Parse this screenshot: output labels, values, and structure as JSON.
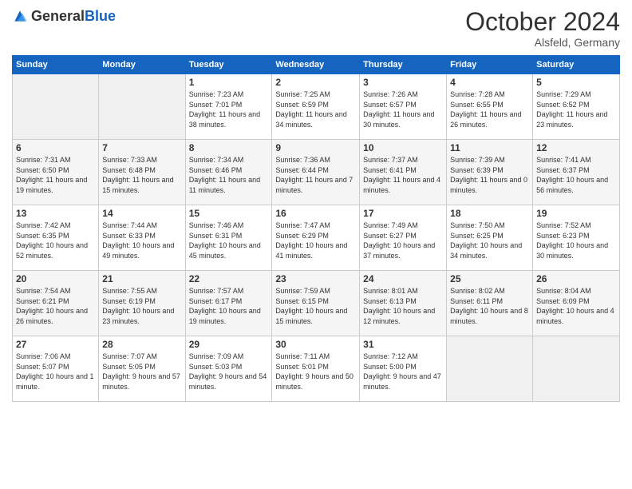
{
  "header": {
    "logo_general": "General",
    "logo_blue": "Blue",
    "month_title": "October 2024",
    "location": "Alsfeld, Germany"
  },
  "days_of_week": [
    "Sunday",
    "Monday",
    "Tuesday",
    "Wednesday",
    "Thursday",
    "Friday",
    "Saturday"
  ],
  "weeks": [
    [
      {
        "day": null
      },
      {
        "day": null
      },
      {
        "day": 1,
        "sunrise": "Sunrise: 7:23 AM",
        "sunset": "Sunset: 7:01 PM",
        "daylight": "Daylight: 11 hours and 38 minutes."
      },
      {
        "day": 2,
        "sunrise": "Sunrise: 7:25 AM",
        "sunset": "Sunset: 6:59 PM",
        "daylight": "Daylight: 11 hours and 34 minutes."
      },
      {
        "day": 3,
        "sunrise": "Sunrise: 7:26 AM",
        "sunset": "Sunset: 6:57 PM",
        "daylight": "Daylight: 11 hours and 30 minutes."
      },
      {
        "day": 4,
        "sunrise": "Sunrise: 7:28 AM",
        "sunset": "Sunset: 6:55 PM",
        "daylight": "Daylight: 11 hours and 26 minutes."
      },
      {
        "day": 5,
        "sunrise": "Sunrise: 7:29 AM",
        "sunset": "Sunset: 6:52 PM",
        "daylight": "Daylight: 11 hours and 23 minutes."
      }
    ],
    [
      {
        "day": 6,
        "sunrise": "Sunrise: 7:31 AM",
        "sunset": "Sunset: 6:50 PM",
        "daylight": "Daylight: 11 hours and 19 minutes."
      },
      {
        "day": 7,
        "sunrise": "Sunrise: 7:33 AM",
        "sunset": "Sunset: 6:48 PM",
        "daylight": "Daylight: 11 hours and 15 minutes."
      },
      {
        "day": 8,
        "sunrise": "Sunrise: 7:34 AM",
        "sunset": "Sunset: 6:46 PM",
        "daylight": "Daylight: 11 hours and 11 minutes."
      },
      {
        "day": 9,
        "sunrise": "Sunrise: 7:36 AM",
        "sunset": "Sunset: 6:44 PM",
        "daylight": "Daylight: 11 hours and 7 minutes."
      },
      {
        "day": 10,
        "sunrise": "Sunrise: 7:37 AM",
        "sunset": "Sunset: 6:41 PM",
        "daylight": "Daylight: 11 hours and 4 minutes."
      },
      {
        "day": 11,
        "sunrise": "Sunrise: 7:39 AM",
        "sunset": "Sunset: 6:39 PM",
        "daylight": "Daylight: 11 hours and 0 minutes."
      },
      {
        "day": 12,
        "sunrise": "Sunrise: 7:41 AM",
        "sunset": "Sunset: 6:37 PM",
        "daylight": "Daylight: 10 hours and 56 minutes."
      }
    ],
    [
      {
        "day": 13,
        "sunrise": "Sunrise: 7:42 AM",
        "sunset": "Sunset: 6:35 PM",
        "daylight": "Daylight: 10 hours and 52 minutes."
      },
      {
        "day": 14,
        "sunrise": "Sunrise: 7:44 AM",
        "sunset": "Sunset: 6:33 PM",
        "daylight": "Daylight: 10 hours and 49 minutes."
      },
      {
        "day": 15,
        "sunrise": "Sunrise: 7:46 AM",
        "sunset": "Sunset: 6:31 PM",
        "daylight": "Daylight: 10 hours and 45 minutes."
      },
      {
        "day": 16,
        "sunrise": "Sunrise: 7:47 AM",
        "sunset": "Sunset: 6:29 PM",
        "daylight": "Daylight: 10 hours and 41 minutes."
      },
      {
        "day": 17,
        "sunrise": "Sunrise: 7:49 AM",
        "sunset": "Sunset: 6:27 PM",
        "daylight": "Daylight: 10 hours and 37 minutes."
      },
      {
        "day": 18,
        "sunrise": "Sunrise: 7:50 AM",
        "sunset": "Sunset: 6:25 PM",
        "daylight": "Daylight: 10 hours and 34 minutes."
      },
      {
        "day": 19,
        "sunrise": "Sunrise: 7:52 AM",
        "sunset": "Sunset: 6:23 PM",
        "daylight": "Daylight: 10 hours and 30 minutes."
      }
    ],
    [
      {
        "day": 20,
        "sunrise": "Sunrise: 7:54 AM",
        "sunset": "Sunset: 6:21 PM",
        "daylight": "Daylight: 10 hours and 26 minutes."
      },
      {
        "day": 21,
        "sunrise": "Sunrise: 7:55 AM",
        "sunset": "Sunset: 6:19 PM",
        "daylight": "Daylight: 10 hours and 23 minutes."
      },
      {
        "day": 22,
        "sunrise": "Sunrise: 7:57 AM",
        "sunset": "Sunset: 6:17 PM",
        "daylight": "Daylight: 10 hours and 19 minutes."
      },
      {
        "day": 23,
        "sunrise": "Sunrise: 7:59 AM",
        "sunset": "Sunset: 6:15 PM",
        "daylight": "Daylight: 10 hours and 15 minutes."
      },
      {
        "day": 24,
        "sunrise": "Sunrise: 8:01 AM",
        "sunset": "Sunset: 6:13 PM",
        "daylight": "Daylight: 10 hours and 12 minutes."
      },
      {
        "day": 25,
        "sunrise": "Sunrise: 8:02 AM",
        "sunset": "Sunset: 6:11 PM",
        "daylight": "Daylight: 10 hours and 8 minutes."
      },
      {
        "day": 26,
        "sunrise": "Sunrise: 8:04 AM",
        "sunset": "Sunset: 6:09 PM",
        "daylight": "Daylight: 10 hours and 4 minutes."
      }
    ],
    [
      {
        "day": 27,
        "sunrise": "Sunrise: 7:06 AM",
        "sunset": "Sunset: 5:07 PM",
        "daylight": "Daylight: 10 hours and 1 minute."
      },
      {
        "day": 28,
        "sunrise": "Sunrise: 7:07 AM",
        "sunset": "Sunset: 5:05 PM",
        "daylight": "Daylight: 9 hours and 57 minutes."
      },
      {
        "day": 29,
        "sunrise": "Sunrise: 7:09 AM",
        "sunset": "Sunset: 5:03 PM",
        "daylight": "Daylight: 9 hours and 54 minutes."
      },
      {
        "day": 30,
        "sunrise": "Sunrise: 7:11 AM",
        "sunset": "Sunset: 5:01 PM",
        "daylight": "Daylight: 9 hours and 50 minutes."
      },
      {
        "day": 31,
        "sunrise": "Sunrise: 7:12 AM",
        "sunset": "Sunset: 5:00 PM",
        "daylight": "Daylight: 9 hours and 47 minutes."
      },
      {
        "day": null
      },
      {
        "day": null
      }
    ]
  ]
}
